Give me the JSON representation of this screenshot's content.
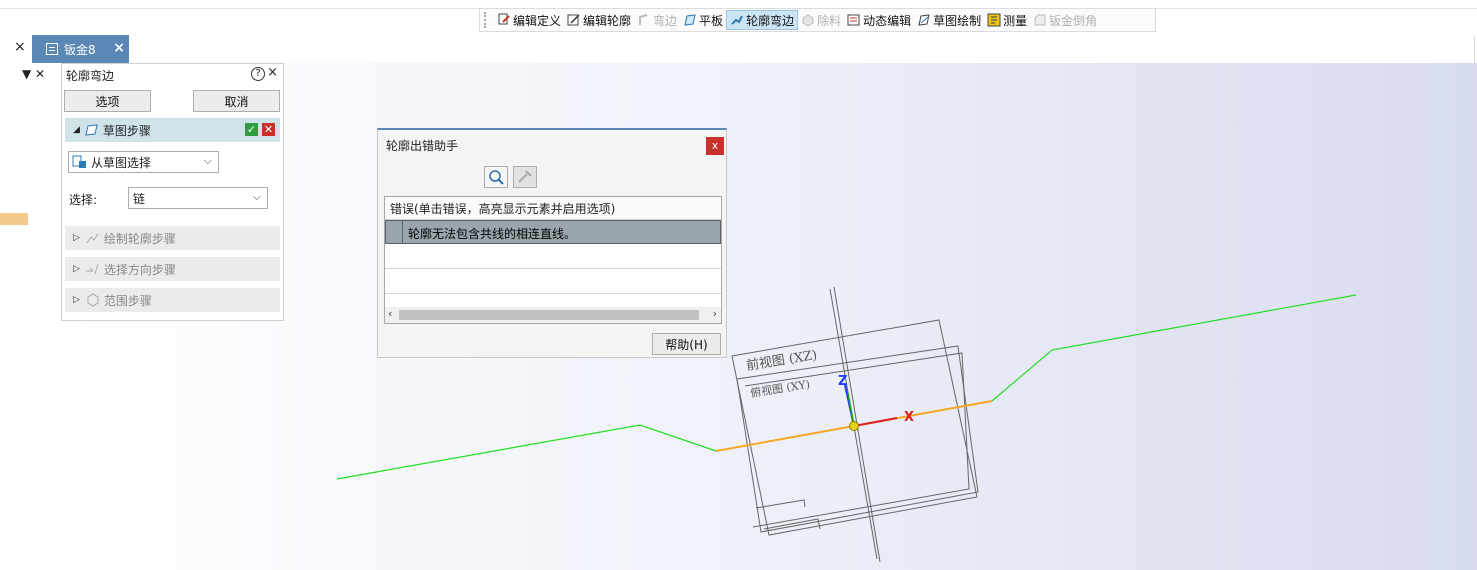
{
  "toolbar": {
    "items": [
      {
        "label": "编辑定义",
        "icon": "edit-definition-icon",
        "state": "normal"
      },
      {
        "label": "编辑轮廓",
        "icon": "edit-profile-icon",
        "state": "normal"
      },
      {
        "label": "弯边",
        "icon": "flange-icon",
        "state": "disabled"
      },
      {
        "label": "平板",
        "icon": "flat-plate-icon",
        "state": "normal"
      },
      {
        "label": "轮廓弯边",
        "icon": "contour-flange-icon",
        "state": "active"
      },
      {
        "label": "除料",
        "icon": "cut-icon",
        "state": "disabled"
      },
      {
        "label": "动态编辑",
        "icon": "dynamic-edit-icon",
        "state": "normal"
      },
      {
        "label": "草图绘制",
        "icon": "sketch-icon",
        "state": "normal"
      },
      {
        "label": "测量",
        "icon": "measure-icon",
        "state": "normal"
      },
      {
        "label": "钣金倒角",
        "icon": "sheetmetal-chamfer-icon",
        "state": "disabled"
      }
    ]
  },
  "tabs": {
    "close_glyph": "×",
    "document": {
      "label": "钣金8",
      "close_glyph": "×"
    }
  },
  "panel": {
    "title": "轮廓弯边",
    "help_glyph": "?",
    "close_glyph": "×",
    "options_button": "选项",
    "cancel_button": "取消",
    "step_sketch": "草图步骤",
    "source_select": "从草图选择",
    "selection_label": "选择:",
    "selection_value": "链",
    "step_draw_profile": "绘制轮廓步骤",
    "step_direction": "选择方向步骤",
    "step_range": "范围步骤"
  },
  "dialog": {
    "title": "轮廓出错助手",
    "close_glyph": "x",
    "list_header": "错误(单击错误，高亮显示元素并启用选项)",
    "errors": [
      "轮廓无法包含共线的相连直线。"
    ],
    "help_button": "帮助(H)"
  },
  "viewport": {
    "plane_front": "前视图 (XZ)",
    "plane_top": "俯视图 (XY)",
    "axis_z": "Z",
    "axis_x": "X",
    "colors": {
      "sketch_line": "#22dd22",
      "highlight_line": "#f5a623",
      "axis_x": "#e02020",
      "axis_z": "#1a3cff"
    }
  }
}
